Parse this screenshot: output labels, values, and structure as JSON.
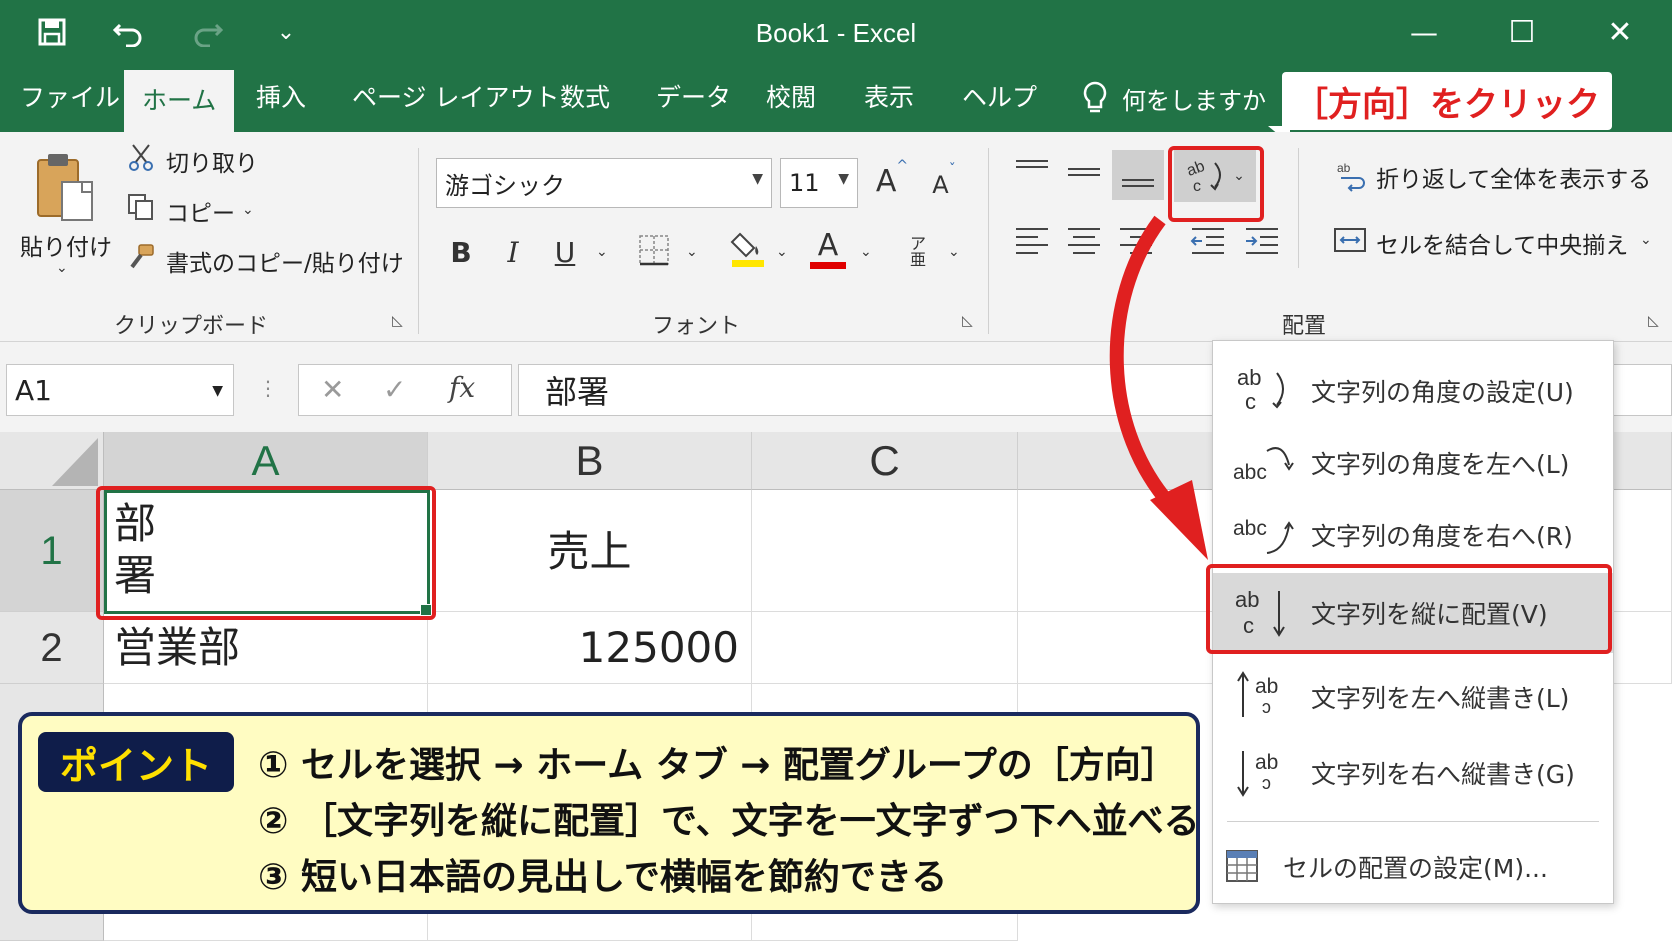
{
  "window": {
    "title": "Book1  -  Excel",
    "controls": {
      "minimize": "—",
      "maximize": "☐",
      "close": "✕"
    }
  },
  "quick_access": {
    "customize": "⌄"
  },
  "tabs": [
    {
      "label": "ファイル"
    },
    {
      "label": "ホーム",
      "active": true
    },
    {
      "label": "挿入"
    },
    {
      "label": "ページ レイアウト"
    },
    {
      "label": "数式"
    },
    {
      "label": "データ"
    },
    {
      "label": "校閲"
    },
    {
      "label": "表示"
    },
    {
      "label": "ヘルプ"
    }
  ],
  "tellme": {
    "label": "何をしますか"
  },
  "callout": {
    "text": "［方向］をクリック"
  },
  "clipboard": {
    "paste_label": "貼り付け",
    "cut_label": "切り取り",
    "copy_label": "コピー",
    "format_painter_label": "書式のコピー/貼り付け",
    "group_label": "クリップボード"
  },
  "font": {
    "font_name": "游ゴシック",
    "font_size": "11",
    "grow_label": "A",
    "shrink_label": "A",
    "bold_label": "B",
    "italic_label": "I",
    "underline_label": "U",
    "color_label": "A",
    "group_label": "フォント",
    "highlight_color": "#ffe600",
    "font_color": "#e00000"
  },
  "alignment": {
    "wrap_label": "折り返して全体を表示する",
    "merge_label": "セルを結合して中央揃え",
    "group_label": "配置"
  },
  "formula_bar": {
    "name_box": "A1",
    "fx_label": "fx",
    "formula": "部署"
  },
  "sheet": {
    "columns": [
      "A",
      "B",
      "C"
    ],
    "rows": [
      {
        "header": "1",
        "a_line1": "部",
        "a_line2": "署",
        "b": "売上"
      },
      {
        "header": "2",
        "a": "営業部",
        "b": "125000"
      }
    ]
  },
  "point": {
    "badge": "ポイント",
    "lines": [
      "① セルを選択 → ホーム タブ → 配置グループの［方向］",
      "② ［文字列を縦に配置］で、文字を一文字ずつ下へ並べる",
      "③ 短い日本語の見出しで横幅を節約できる"
    ]
  },
  "orientation_menu": {
    "items": [
      {
        "label": "文字列の角度の設定(U)",
        "icon": "angle-counterclockwise-icon"
      },
      {
        "label": "文字列の角度を左へ(L)",
        "icon": "angle-left-icon"
      },
      {
        "label": "文字列の角度を右へ(R)",
        "icon": "angle-right-icon"
      },
      {
        "label": "文字列を縦に配置(V)",
        "icon": "vertical-text-icon",
        "selected": true
      },
      {
        "label": "文字列を左へ縦書き(L)",
        "icon": "rotate-up-icon"
      },
      {
        "label": "文字列を右へ縦書き(G)",
        "icon": "rotate-down-icon"
      },
      {
        "label": "セルの配置の設定(M)...",
        "icon": "format-cells-icon"
      }
    ]
  },
  "colors": {
    "excel_green": "#217346",
    "highlight_red": "#e02020",
    "point_bg": "#fffcc2",
    "point_border": "#1a2a5e"
  }
}
